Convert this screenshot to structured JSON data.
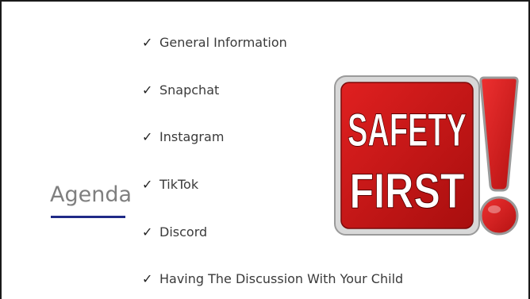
{
  "slide": {
    "title": "Agenda",
    "items": [
      {
        "check": "✓",
        "text": "General Information"
      },
      {
        "check": "✓",
        "text": "Snapchat"
      },
      {
        "check": "✓",
        "text": "Instagram"
      },
      {
        "check": "✓",
        "text": "TikTok"
      },
      {
        "check": "✓",
        "text": "Discord"
      },
      {
        "check": "✓",
        "text": "Having The Discussion With Your Child"
      }
    ]
  },
  "image": {
    "line1": "SAFETY",
    "line2": "FIRST",
    "colors": {
      "red": "#c81414",
      "dark_red": "#7a0a0a",
      "white": "#ffffff"
    },
    "icon": "exclamation-icon"
  },
  "colors": {
    "accent": "#1f2a87",
    "title": "#7f7f7f",
    "text": "#3a3a3a"
  }
}
